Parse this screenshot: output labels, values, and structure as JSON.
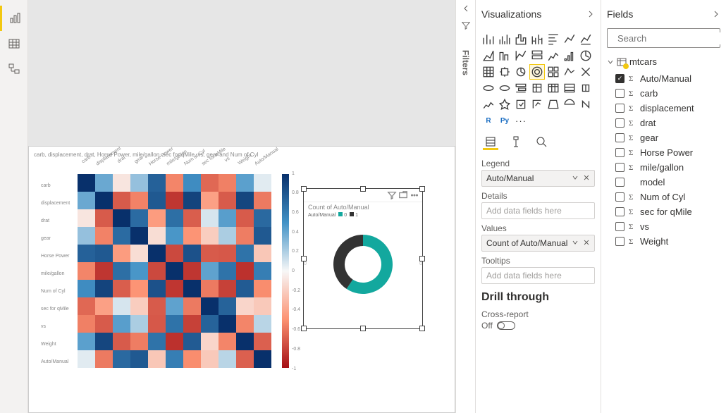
{
  "filters": {
    "label": "Filters"
  },
  "visualizations": {
    "title": "Visualizations",
    "wells": {
      "legend": {
        "label": "Legend",
        "value": "Auto/Manual"
      },
      "details": {
        "label": "Details",
        "placeholder": "Add data fields here"
      },
      "values": {
        "label": "Values",
        "value": "Count of Auto/Manual"
      },
      "tooltips": {
        "label": "Tooltips",
        "placeholder": "Add data fields here"
      }
    },
    "drill_through": {
      "title": "Drill through",
      "cross_report_label": "Cross-report",
      "toggle_state": "Off"
    }
  },
  "fields": {
    "title": "Fields",
    "search_placeholder": "Search",
    "table": "mtcars",
    "items": [
      {
        "name": "Auto/Manual",
        "checked": true,
        "numeric": true
      },
      {
        "name": "carb",
        "checked": false,
        "numeric": true
      },
      {
        "name": "displacement",
        "checked": false,
        "numeric": true
      },
      {
        "name": "drat",
        "checked": false,
        "numeric": true
      },
      {
        "name": "gear",
        "checked": false,
        "numeric": true
      },
      {
        "name": "Horse Power",
        "checked": false,
        "numeric": true
      },
      {
        "name": "mile/gallon",
        "checked": false,
        "numeric": true
      },
      {
        "name": "model",
        "checked": false,
        "numeric": false
      },
      {
        "name": "Num of Cyl",
        "checked": false,
        "numeric": true
      },
      {
        "name": "sec for qMile",
        "checked": false,
        "numeric": true
      },
      {
        "name": "vs",
        "checked": false,
        "numeric": true
      },
      {
        "name": "Weight",
        "checked": false,
        "numeric": true
      }
    ]
  },
  "heatmap": {
    "title": "carb, displacement, drat, Horse Power, mile/gallon, sec for qMile, vs, gear and Num of Cyl",
    "labels": [
      "carb",
      "displacement",
      "drat",
      "gear",
      "Horse Power",
      "mile/gallon",
      "Num of Cyl",
      "sec for qMile",
      "vs",
      "Weight",
      "Auto/Manual"
    ]
  },
  "donut": {
    "title": "Count of Auto/Manual",
    "legend_label": "Auto/Manual",
    "legend_items": [
      {
        "label": "0",
        "color": "#13A89E"
      },
      {
        "label": "1",
        "color": "#333333"
      }
    ],
    "x_left_label": "0",
    "x_right_label": "0"
  },
  "chart_data": [
    {
      "type": "heatmap",
      "title": "carb, displacement, drat, Horse Power, mile/gallon, sec for qMile, vs, gear and Num of Cyl",
      "x_labels": [
        "carb",
        "displacement",
        "drat",
        "gear",
        "Horse Power",
        "mile/gallon",
        "Num of Cyl",
        "sec for qMile",
        "vs",
        "Weight",
        "Auto/Manual"
      ],
      "y_labels": [
        "carb",
        "displacement",
        "drat",
        "gear",
        "Horse Power",
        "mile/gallon",
        "Num of Cyl",
        "sec for qMile",
        "vs",
        "Weight",
        "Auto/Manual"
      ],
      "colorbar": {
        "ticks": [
          1.0,
          0.8,
          0.6,
          0.4,
          0.2,
          0.0,
          -0.2,
          -0.4,
          -0.6,
          -0.8,
          -1.0
        ]
      },
      "matrix": [
        [
          1.0,
          0.39,
          -0.09,
          0.27,
          0.75,
          -0.55,
          0.53,
          -0.66,
          -0.57,
          0.43,
          0.06
        ],
        [
          0.39,
          1.0,
          -0.71,
          -0.56,
          0.79,
          -0.85,
          0.9,
          -0.43,
          -0.71,
          0.89,
          -0.59
        ],
        [
          -0.09,
          -0.71,
          1.0,
          0.7,
          -0.45,
          0.68,
          -0.7,
          0.09,
          0.44,
          -0.71,
          0.71
        ],
        [
          0.27,
          -0.56,
          0.7,
          1.0,
          -0.13,
          0.48,
          -0.49,
          -0.21,
          0.21,
          -0.58,
          0.79
        ],
        [
          0.75,
          0.79,
          -0.45,
          -0.13,
          1.0,
          -0.78,
          0.83,
          -0.71,
          -0.72,
          0.66,
          -0.24
        ],
        [
          -0.55,
          -0.85,
          0.68,
          0.48,
          -0.78,
          1.0,
          -0.85,
          0.42,
          0.66,
          -0.87,
          0.6
        ],
        [
          0.53,
          0.9,
          -0.7,
          -0.49,
          0.83,
          -0.85,
          1.0,
          -0.59,
          -0.81,
          0.78,
          -0.52
        ],
        [
          -0.66,
          -0.43,
          0.09,
          -0.21,
          -0.71,
          0.42,
          -0.59,
          1.0,
          0.74,
          -0.17,
          -0.23
        ],
        [
          -0.57,
          -0.71,
          0.44,
          0.21,
          -0.72,
          0.66,
          -0.81,
          0.74,
          1.0,
          -0.55,
          0.17
        ],
        [
          0.43,
          0.89,
          -0.71,
          -0.58,
          0.66,
          -0.87,
          0.78,
          -0.17,
          -0.55,
          1.0,
          -0.69
        ],
        [
          0.06,
          -0.59,
          0.71,
          0.79,
          -0.24,
          0.6,
          -0.52,
          -0.23,
          0.17,
          -0.69,
          1.0
        ]
      ]
    },
    {
      "type": "pie",
      "title": "Count of Auto/Manual",
      "series": [
        {
          "name": "0",
          "value": 19,
          "color": "#13A89E"
        },
        {
          "name": "1",
          "value": 13,
          "color": "#333333"
        }
      ]
    }
  ]
}
